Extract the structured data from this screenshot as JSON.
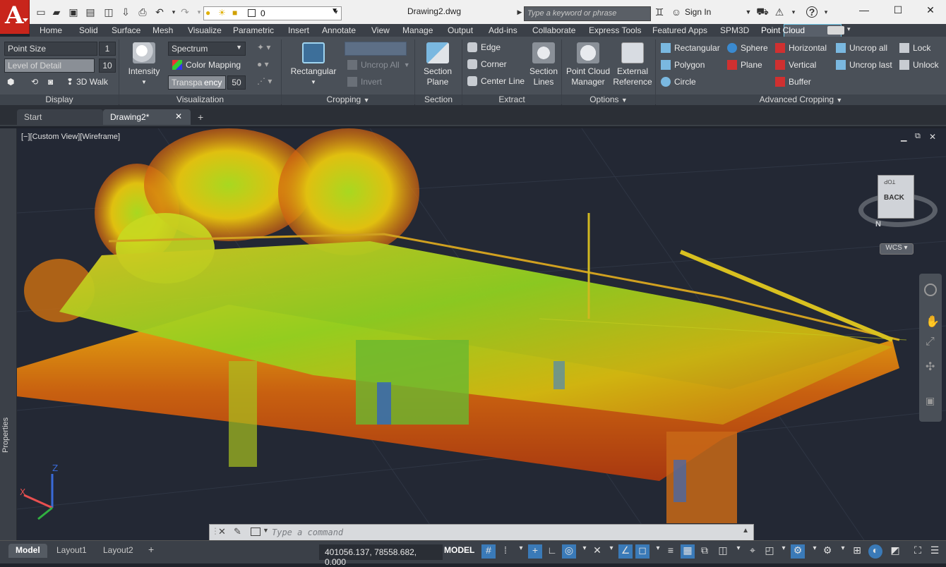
{
  "title_bar": {
    "app_logo": "A",
    "title": "Drawing2.dwg",
    "layer_name": "0",
    "search_placeholder": "Type a keyword or phrase",
    "sign_in": "Sign In"
  },
  "ribbon_tabs": [
    "Home",
    "Solid",
    "Surface",
    "Mesh",
    "Visualize",
    "Parametric",
    "Insert",
    "Annotate",
    "View",
    "Manage",
    "Output",
    "Add-ins",
    "Collaborate",
    "Express Tools",
    "Featured Apps",
    "SPM3D",
    "Point Cloud"
  ],
  "active_tab": "Point Cloud",
  "display_panel": {
    "point_size_label": "Point Size",
    "point_size_value": "1",
    "lod_label": "Level of Detail",
    "lod_value": "10",
    "walk": "3D Walk",
    "group": "Display"
  },
  "visualization_panel": {
    "intensity": "Intensity",
    "spectrum": "Spectrum",
    "color_mapping": "Color Mapping",
    "transparency_a": "Transpa",
    "transparency_b": "ency",
    "transparency_value": "50",
    "group": "Visualization"
  },
  "cropping_panel": {
    "rectangular": "Rectangular",
    "uncrop_all": "Uncrop All",
    "invert": "Invert",
    "group": "Cropping"
  },
  "section_panel": {
    "section_plane_1": "Section",
    "section_plane_2": "Plane",
    "group": "Section"
  },
  "extract_panel": {
    "edge": "Edge",
    "corner": "Corner",
    "center_line": "Center Line",
    "section_lines_1": "Section",
    "section_lines_2": "Lines",
    "group": "Extract"
  },
  "options_panel": {
    "manager_1": "Point Cloud",
    "manager_2": "Manager",
    "extref_1": "External",
    "extref_2": "Reference",
    "group": "Options"
  },
  "advanced_panel": {
    "rectangular": "Rectangular",
    "polygon": "Polygon",
    "circle": "Circle",
    "sphere": "Sphere",
    "plane": "Plane",
    "horizontal": "Horizontal",
    "vertical": "Vertical",
    "buffer": "Buffer",
    "uncrop_all": "Uncrop all",
    "uncrop_last": "Uncrop last",
    "lock": "Lock",
    "unlock": "Unlock",
    "group": "Advanced Cropping"
  },
  "doc_tabs": {
    "start": "Start",
    "drawing": "Drawing2*"
  },
  "viewport": {
    "label": "[−][Custom View][Wireframe]",
    "properties": "Properties",
    "viewcube_face": "BACK",
    "viewcube_top": "TOP",
    "compass_n": "N",
    "wcs": "WCS"
  },
  "command": {
    "placeholder": "Type a command"
  },
  "status": {
    "coords": "401056.137, 78558.682, 0.000",
    "model": "MODEL",
    "layout_tabs": [
      "Model",
      "Layout1",
      "Layout2"
    ]
  },
  "colors": {
    "ribbon": "#4a5058",
    "accent": "#72c8e8",
    "logo": "#c8251b"
  }
}
